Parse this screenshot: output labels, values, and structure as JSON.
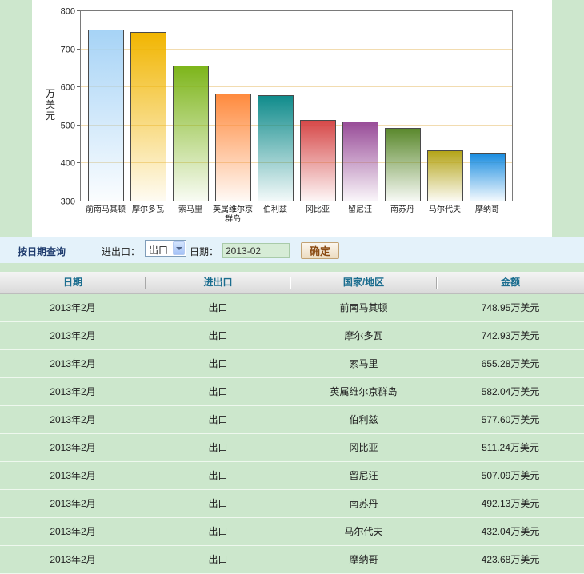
{
  "chart_data": {
    "type": "bar",
    "categories": [
      "前南马其顿",
      "摩尔多瓦",
      "索马里",
      "英属维尔京群岛",
      "伯利兹",
      "冈比亚",
      "留尼汪",
      "南苏丹",
      "马尔代夫",
      "摩纳哥"
    ],
    "values": [
      748.95,
      742.93,
      655.28,
      582.04,
      577.6,
      511.24,
      507.09,
      492.13,
      432.04,
      423.68
    ],
    "colors": [
      "#a6d3f6",
      "#f1b500",
      "#7db51a",
      "#ff8a3d",
      "#0f8b8b",
      "#d64848",
      "#984c98",
      "#5a882c",
      "#b3a316",
      "#1b8de0"
    ],
    "ylabel": "万美元",
    "ylim": [
      300,
      800
    ],
    "yticks": [
      300,
      400,
      500,
      600,
      700,
      800
    ],
    "grid": true,
    "legend": "none"
  },
  "query": {
    "title": "按日期查询",
    "direction_label": "进出口：",
    "direction_value": "出口",
    "date_label": "日期：",
    "date_value": "2013-02",
    "submit_label": "确定"
  },
  "table": {
    "headers": [
      "日期",
      "进出口",
      "国家/地区",
      "金额"
    ],
    "rows": [
      [
        "2013年2月",
        "出口",
        "前南马其顿",
        "748.95万美元"
      ],
      [
        "2013年2月",
        "出口",
        "摩尔多瓦",
        "742.93万美元"
      ],
      [
        "2013年2月",
        "出口",
        "索马里",
        "655.28万美元"
      ],
      [
        "2013年2月",
        "出口",
        "英属维尔京群岛",
        "582.04万美元"
      ],
      [
        "2013年2月",
        "出口",
        "伯利兹",
        "577.60万美元"
      ],
      [
        "2013年2月",
        "出口",
        "冈比亚",
        "511.24万美元"
      ],
      [
        "2013年2月",
        "出口",
        "留尼汪",
        "507.09万美元"
      ],
      [
        "2013年2月",
        "出口",
        "南苏丹",
        "492.13万美元"
      ],
      [
        "2013年2月",
        "出口",
        "马尔代夫",
        "432.04万美元"
      ],
      [
        "2013年2月",
        "出口",
        "摩纳哥",
        "423.68万美元"
      ]
    ]
  }
}
